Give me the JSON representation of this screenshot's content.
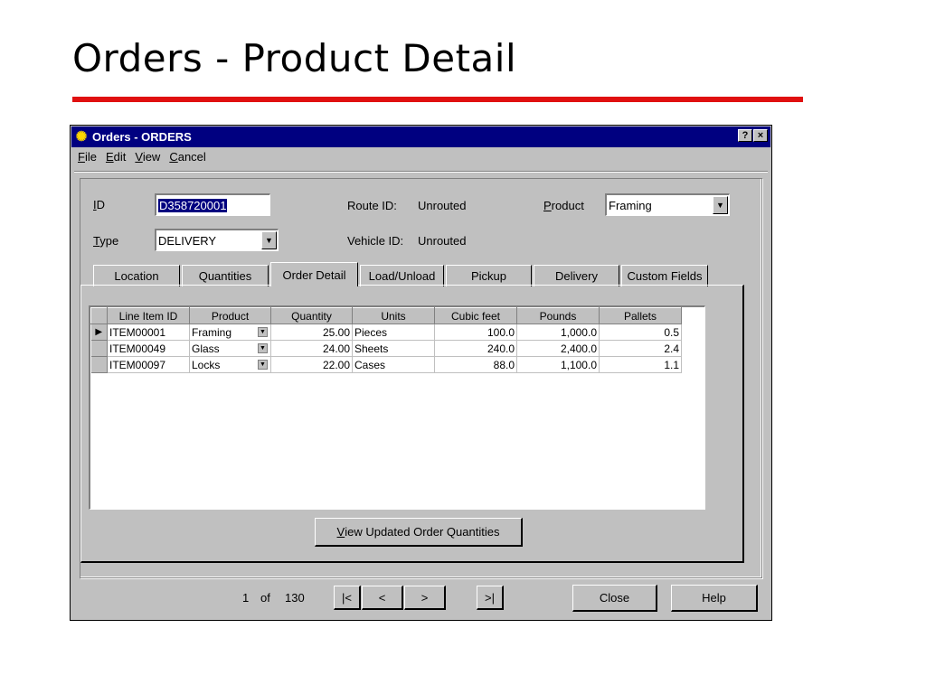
{
  "slide": {
    "title": "Orders - Product Detail",
    "accent_color": "#e01010"
  },
  "window": {
    "icon": "sun-icon",
    "title": "Orders - ORDERS",
    "help_button": "?",
    "close_button": "×"
  },
  "menu": {
    "items": [
      {
        "hotkey": "F",
        "rest": "ile"
      },
      {
        "hotkey": "E",
        "rest": "dit"
      },
      {
        "hotkey": "V",
        "rest": "iew"
      },
      {
        "hotkey": "C",
        "rest": "ancel"
      }
    ]
  },
  "form": {
    "id_label_hotkey": "I",
    "id_label_rest": "D",
    "id_value": "D358720001",
    "type_label_hotkey": "T",
    "type_label_rest": "ype",
    "type_value": "DELIVERY",
    "route_label": "Route ID:",
    "route_value": "Unrouted",
    "vehicle_label": "Vehicle ID:",
    "vehicle_value": "Unrouted",
    "product_label_hotkey": "P",
    "product_label_rest": "roduct",
    "product_value": "Framing"
  },
  "tabs": [
    "Location",
    "Quantities",
    "Order Detail",
    "Load/Unload",
    "Pickup",
    "Delivery",
    "Custom Fields"
  ],
  "active_tab": "Order Detail",
  "grid": {
    "columns": [
      "Line Item ID",
      "Product",
      "Quantity",
      "Units",
      "Cubic feet",
      "Pounds",
      "Pallets"
    ],
    "rows": [
      {
        "current": "▶",
        "line_item_id": "ITEM00001",
        "product": "Framing",
        "quantity": "25.00",
        "units": "Pieces",
        "cubic_feet": "100.0",
        "pounds": "1,000.0",
        "pallets": "0.5"
      },
      {
        "current": "",
        "line_item_id": "ITEM00049",
        "product": "Glass",
        "quantity": "24.00",
        "units": "Sheets",
        "cubic_feet": "240.0",
        "pounds": "2,400.0",
        "pallets": "2.4"
      },
      {
        "current": "",
        "line_item_id": "ITEM00097",
        "product": "Locks",
        "quantity": "22.00",
        "units": "Cases",
        "cubic_feet": "88.0",
        "pounds": "1,100.0",
        "pallets": "1.1"
      }
    ]
  },
  "view_button": {
    "hotkey": "V",
    "rest": "iew Updated Order Quantities"
  },
  "pager": {
    "current": "1",
    "of_label": "of",
    "total": "130",
    "first": "|<",
    "prev": "<",
    "next": ">",
    "last": ">|"
  },
  "footer": {
    "close_label": "Close",
    "help_label": "Help"
  }
}
